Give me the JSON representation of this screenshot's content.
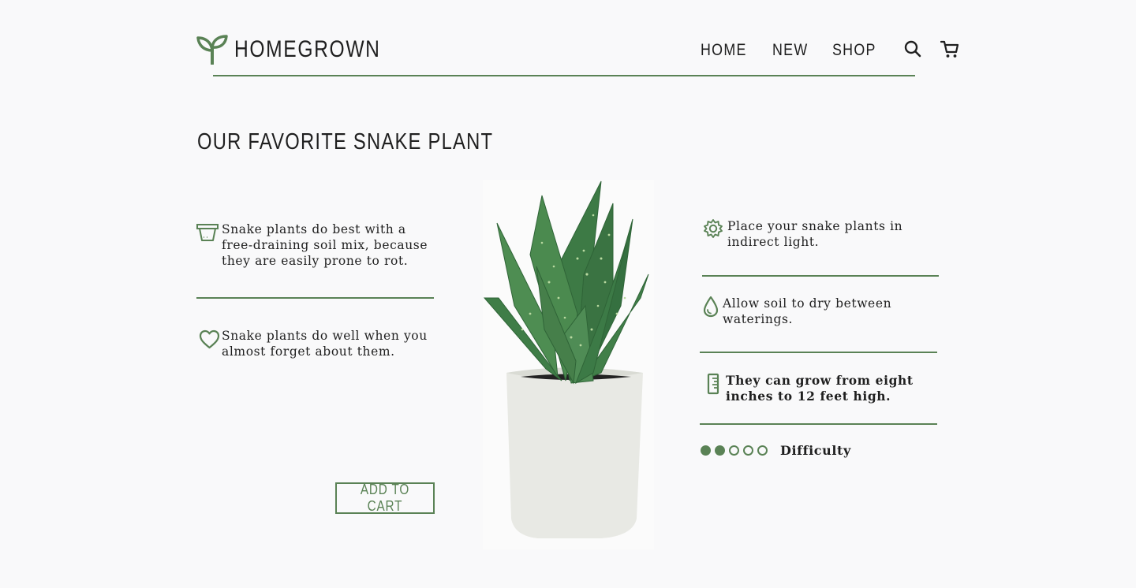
{
  "brand": {
    "name": "HOMEGROWN",
    "logo_icon": "sprout-icon"
  },
  "nav": {
    "items": [
      {
        "label": "HOME"
      },
      {
        "label": "NEW"
      },
      {
        "label": "SHOP"
      }
    ],
    "search_icon": "search-icon",
    "cart_icon": "cart-icon"
  },
  "page": {
    "title": "OUR FAVORITE SNAKE PLANT"
  },
  "left_tips": [
    {
      "icon": "pot-icon",
      "text": "Snake plants do best with a free-draining soil mix, because they are easily prone to rot."
    },
    {
      "icon": "heart-icon",
      "text": "Snake plants do well when you almost forget about them."
    }
  ],
  "right_tips": [
    {
      "icon": "sun-gear-icon",
      "text": "Place your snake plants in indirect light."
    },
    {
      "icon": "water-drop-icon",
      "text": "Allow soil to dry between waterings."
    },
    {
      "icon": "ruler-icon",
      "text": "They can grow from eight inches to 12 feet high."
    }
  ],
  "difficulty": {
    "label": "Difficulty",
    "level": 2,
    "max": 5
  },
  "cta": {
    "add_to_cart": "ADD TO CART"
  },
  "colors": {
    "accent": "#5a8255",
    "background": "#f9f9fa",
    "text": "#1f1f1f"
  }
}
